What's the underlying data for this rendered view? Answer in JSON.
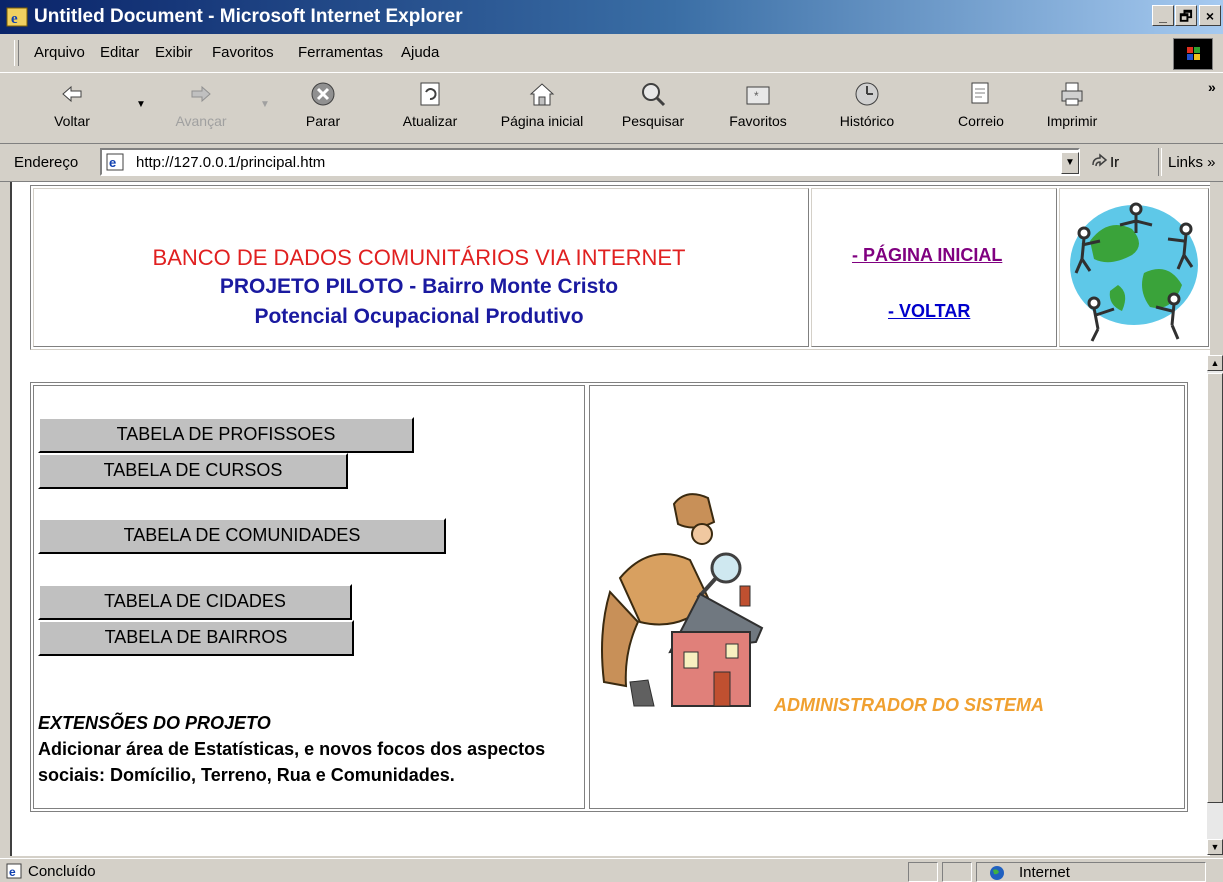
{
  "window": {
    "title": "Untitled Document - Microsoft Internet Explorer",
    "controls": [
      "_",
      "🗗",
      "×"
    ]
  },
  "menu": [
    "Arquivo",
    "Editar",
    "Exibir",
    "Favoritos",
    "Ferramentas",
    "Ajuda"
  ],
  "toolbar": {
    "back": "Voltar",
    "forward": "Avançar",
    "stop": "Parar",
    "refresh": "Atualizar",
    "home": "Página inicial",
    "search": "Pesquisar",
    "favorites": "Favoritos",
    "history": "Histórico",
    "mail": "Correio",
    "print": "Imprimir",
    "more": "»"
  },
  "address": {
    "label": "Endereço",
    "url": "http://127.0.0.1/principal.htm",
    "go": "Ir",
    "links": "Links »"
  },
  "header": {
    "title": "BANCO DE DADOS COMUNITÁRIOS VIA INTERNET",
    "subtitle1": "PROJETO PILOTO - Bairro Monte Cristo",
    "subtitle2": "Potencial Ocupacional Produtivo",
    "link_home": "- PÁGINA INICIAL",
    "link_back": "- VOLTAR"
  },
  "buttons": {
    "profissoes": "TABELA DE PROFISSOES",
    "cursos": "TABELA DE CURSOS",
    "comunidades": "TABELA DE COMUNIDADES",
    "cidades": "TABELA DE CIDADES",
    "bairros": "TABELA DE BAIRROS"
  },
  "extensions": {
    "title": "EXTENSÕES DO PROJETO",
    "body": "Adicionar área de Estatísticas, e novos focos dos aspectos sociais: Domícilio, Terreno, Rua e Comunidades."
  },
  "admin_label": "ADMINISTRADOR DO SISTEMA",
  "status": {
    "text": "Concluído",
    "zone": "Internet"
  },
  "colors": {
    "title_red": "#e02020",
    "title_blue": "#1a1aa0",
    "link_visited": "#800080",
    "link": "#0000cc",
    "admin_orange": "#f0a030"
  }
}
